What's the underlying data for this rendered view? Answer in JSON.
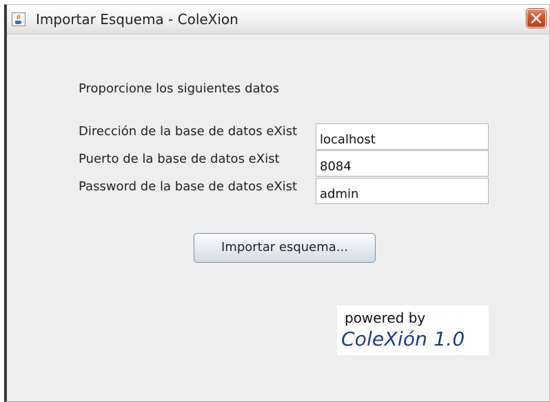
{
  "window": {
    "title": "Importar Esquema - ColeXion",
    "icons": {
      "app": "java-cup-icon",
      "close": "close-icon"
    }
  },
  "form": {
    "intro": "Proporcione los siguientes datos",
    "fields": [
      {
        "label": "Dirección de la base de datos eXist",
        "value": "localhost"
      },
      {
        "label": "Puerto de la base de datos eXist",
        "value": "8084"
      },
      {
        "label": "Password de la base de datos eXist",
        "value": "admin"
      }
    ],
    "import_button": "Importar esquema..."
  },
  "branding": {
    "powered_by": "powered by",
    "product": "ColeXión 1.0",
    "product_color": "#1c3c92"
  }
}
